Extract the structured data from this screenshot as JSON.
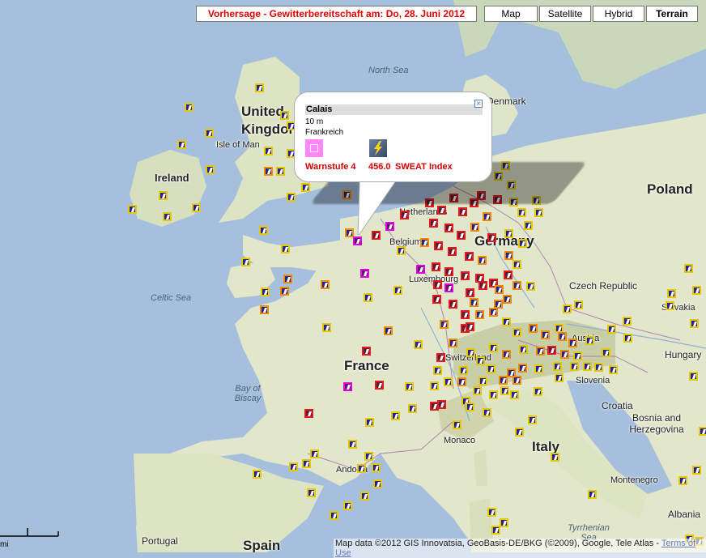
{
  "toolbar": {
    "title": "Vorhersage - Gewitterbereitschaft am: Do, 28. Juni 2012",
    "map_types": [
      {
        "label": "Map",
        "active": false
      },
      {
        "label": "Satellite",
        "active": false
      },
      {
        "label": "Hybrid",
        "active": false
      },
      {
        "label": "Terrain",
        "active": true
      }
    ]
  },
  "labels": {
    "seas": {
      "north_sea": "North Sea",
      "celtic_sea": "Celtic Sea",
      "bay_of_biscay": "Bay of\nBiscay"
    },
    "countries": {
      "united_kingdom": "United Kingdom",
      "ireland": "Ireland",
      "france": "France",
      "germany": "Germany",
      "poland": "Poland",
      "czech": "Czech Republic",
      "spain": "Spain",
      "portugal": "Portugal",
      "italy": "Italy",
      "austria": "Austria",
      "hungary": "Hungary",
      "slovakia": "Slovakia",
      "slovenia": "Slovenia",
      "croatia": "Croatia",
      "bosnia": "Bosnia and\nHerzegovina",
      "montenegro": "Montenegro",
      "albania": "Albania",
      "denmark": "Denmark",
      "netherlands": "Netherlands",
      "belgium": "Belgium",
      "luxembourg": "Luxembourg",
      "switzerland": "Switzerland",
      "monaco": "Monaco",
      "andorra": "Andorra",
      "isle_of_man": "Isle of Man"
    },
    "water": {
      "tyrrhenian": "Tyrrhenian\nSea"
    }
  },
  "popup": {
    "location": "Calais",
    "elevation": "10 m",
    "country": "Frankreich",
    "warn_label": "Warnstufe 4",
    "sweat_value": "456.0",
    "sweat_label": "SWEAT Index",
    "close_icon": "close-icon"
  },
  "colors": {
    "warn_yellow": "#e6c800",
    "warn_orange": "#f08a00",
    "warn_red": "#e51a1a",
    "warn_magenta": "#e000e0",
    "title_red": "#e00000",
    "sea": "#a5bfdd",
    "land": "#e2e7cc"
  },
  "attribution": {
    "text": "Map data ©2012 GIS Innovatsia, GeoBasis-DE/BKG (©2009), Google, Tele Atlas -",
    "terms": "Terms of Use"
  },
  "scale": {
    "unit": "mi"
  }
}
